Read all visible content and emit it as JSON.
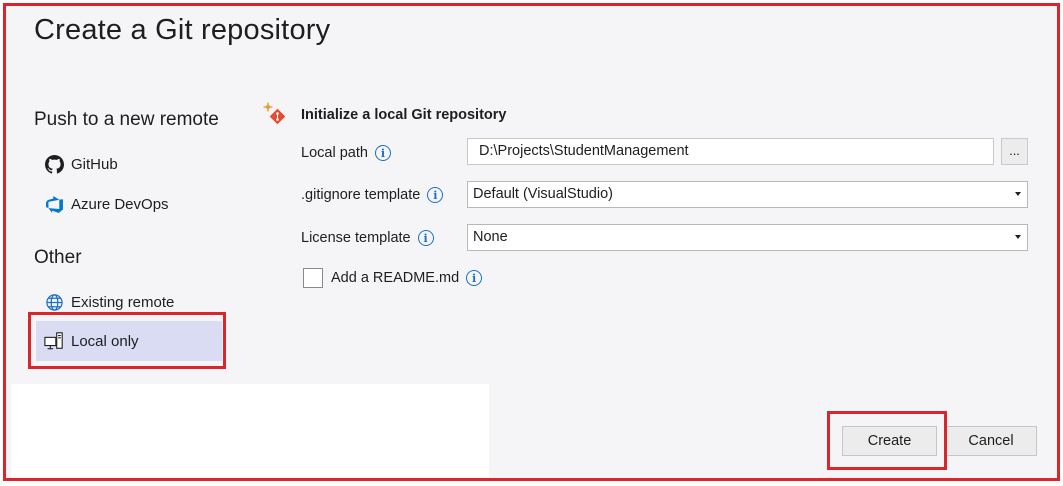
{
  "dialog": {
    "title": "Create a Git repository"
  },
  "sidebar": {
    "push_header": "Push to a new remote",
    "push_items": [
      {
        "label": "GitHub",
        "icon": "github-icon"
      },
      {
        "label": "Azure DevOps",
        "icon": "azure-devops-icon"
      }
    ],
    "other_header": "Other",
    "other_items": [
      {
        "label": "Existing remote",
        "icon": "globe-icon"
      },
      {
        "label": "Local only",
        "icon": "local-computer-icon",
        "selected": true
      }
    ]
  },
  "form": {
    "title": "Initialize a local Git repository",
    "local_path": {
      "label": "Local path",
      "value": "D:\\Projects\\StudentManagement",
      "browse_label": "..."
    },
    "gitignore": {
      "label": ".gitignore template",
      "value": "Default (VisualStudio)"
    },
    "license": {
      "label": "License template",
      "value": "None"
    },
    "readme": {
      "label": "Add a README.md",
      "checked": false
    },
    "info_glyph": "i"
  },
  "buttons": {
    "create": "Create",
    "cancel": "Cancel"
  },
  "colors": {
    "highlight_border": "#d9252b",
    "selected_bg": "#dadcf4",
    "info_blue": "#1b6fc6"
  }
}
